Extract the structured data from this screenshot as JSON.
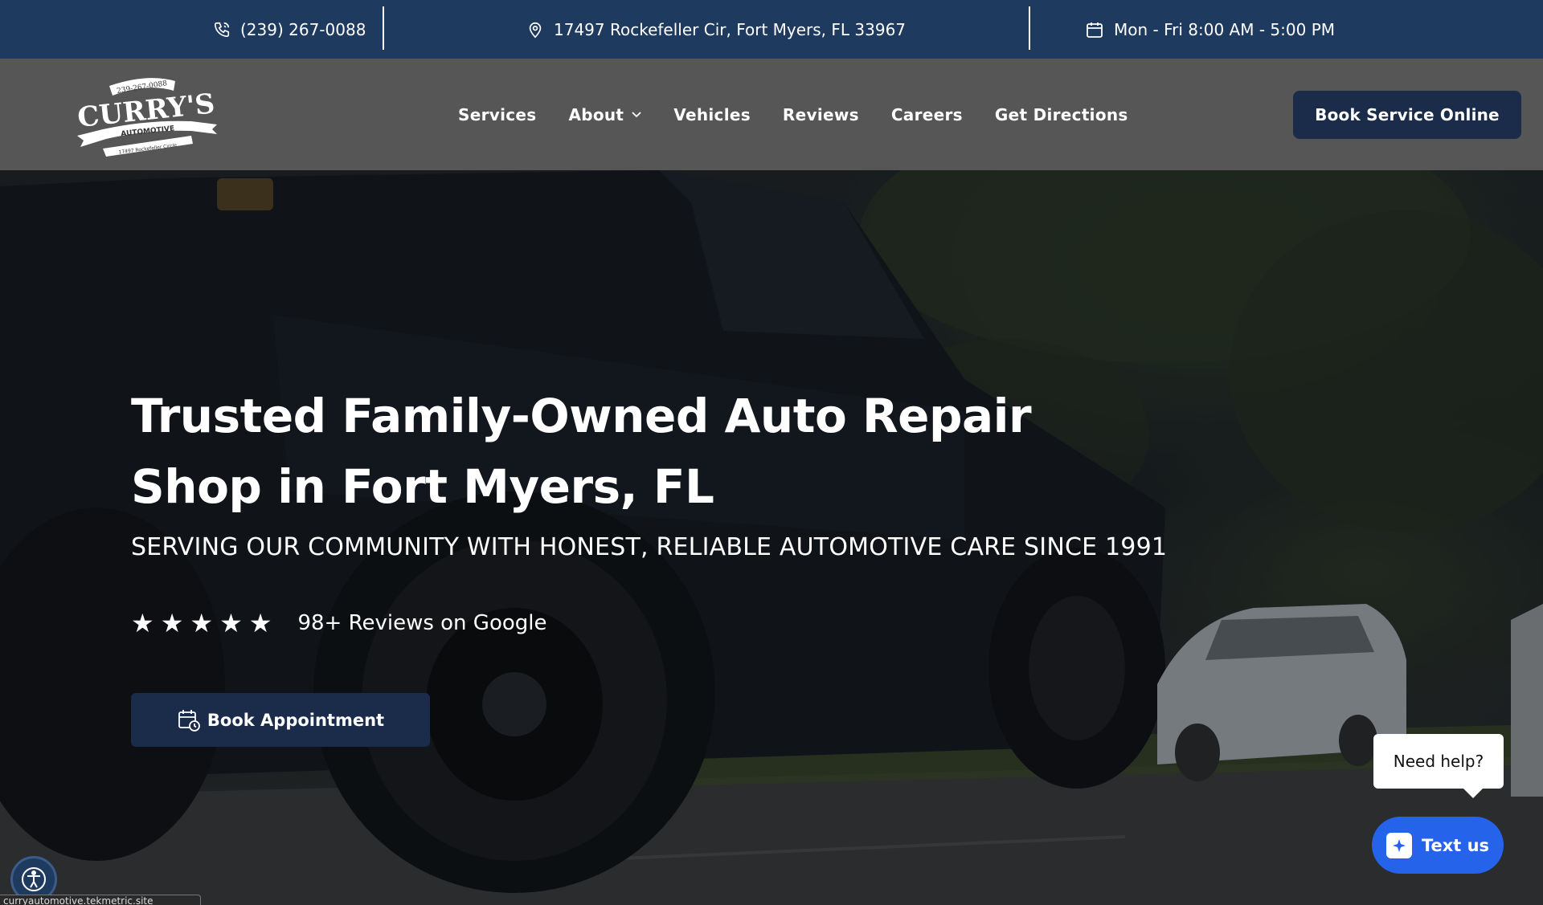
{
  "topbar": {
    "phone": "(239) 267-0088",
    "address": "17497 Rockefeller Cir, Fort Myers, FL 33967",
    "hours": "Mon - Fri 8:00 AM - 5:00 PM"
  },
  "logo": {
    "phone": "239-267-0088",
    "name": "CURRY'S",
    "tagline": "AUTOMOTIVE",
    "street": "17497 Rockefeller Circle"
  },
  "nav": {
    "items": [
      {
        "label": "Services"
      },
      {
        "label": "About"
      },
      {
        "label": "Vehicles"
      },
      {
        "label": "Reviews"
      },
      {
        "label": "Careers"
      },
      {
        "label": "Get Directions"
      }
    ],
    "cta": "Book Service Online"
  },
  "hero": {
    "headline_line1": "Trusted Family-Owned Auto Repair",
    "headline_line2": "Shop in Fort Myers, FL",
    "subline": "SERVING OUR COMMUNITY WITH HONEST, RELIABLE AUTOMOTIVE CARE SINCE 1991",
    "stars": 5,
    "rating_text": "98+ Reviews on Google",
    "cta": "Book Appointment"
  },
  "chat": {
    "bubble": "Need help?",
    "button": "Text us",
    "accent": "#2563eb"
  },
  "status_url": "curryautomotive.tekmetric.site",
  "colors": {
    "topbar_bg": "#1f3a5f",
    "nav_bg": "#565656",
    "button_bg": "#1a2c4a"
  }
}
